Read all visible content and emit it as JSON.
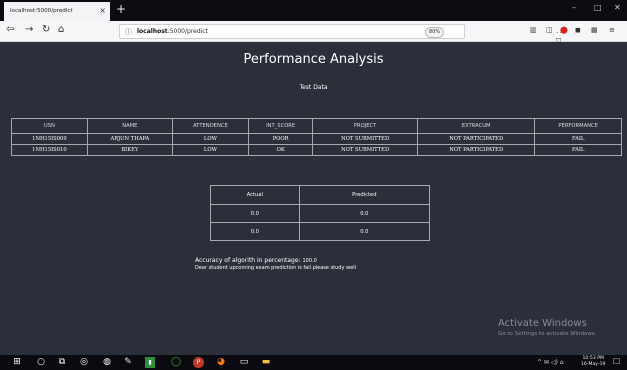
{
  "browser": {
    "tab_title": "localhost:5000/predict",
    "tab_close": "×",
    "new_tab": "+",
    "url_host": "localhost",
    "url_rest": ":5000/predict",
    "zoom": "80%",
    "url_actions": "··· ⛉ ☆",
    "window_controls": [
      "–",
      "□",
      "✕"
    ]
  },
  "page": {
    "title": "Performance Analysis",
    "subtitle": "Test Data"
  },
  "performance_table": {
    "columns": [
      "USN",
      "NAME",
      "ATTENDENCE",
      "INT_SCORE",
      "PROJECT",
      "EXTRACUM",
      "PERFORMANCE"
    ],
    "rows": [
      [
        "1NH15IS009",
        "ARJUN THAPA",
        "LOW",
        "POOR",
        "NOT SUBMITTED",
        "NOT PARTICIPATED",
        "FAIL"
      ],
      [
        "1NH15IS010",
        "BIKEY",
        "LOW",
        "OK",
        "NOT SUBMITTED",
        "NOT PARTICIPATED",
        "FAIL"
      ]
    ]
  },
  "comparison_table": {
    "columns": [
      "Actual",
      "Predicted"
    ],
    "rows": [
      [
        "0.0",
        "0.0"
      ],
      [
        "0.0",
        "0.0"
      ]
    ]
  },
  "accuracy": {
    "label": "Accuracy of algorith in percentage:",
    "value": "100.0"
  },
  "message": "Dear student upcoming exam prediction is fail please study well",
  "watermark": {
    "title": "Activate Windows",
    "subtitle": "Go to Settings to activate Windows."
  },
  "taskbar": {
    "tray": "^ ✉ ◁) ⌂",
    "time": "10:53 PM",
    "date": "16-May-19"
  },
  "colors": {
    "page_bg": "#2b2f3a",
    "table_border": "#a7a8ad",
    "text": "#ffffff"
  }
}
